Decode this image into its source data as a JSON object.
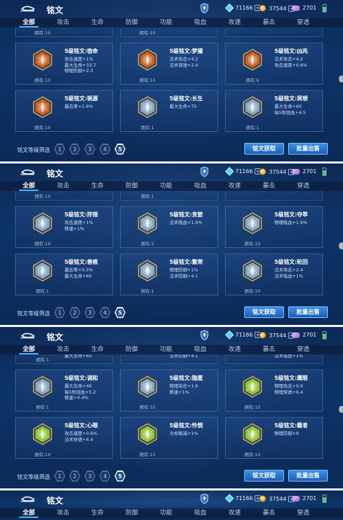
{
  "page_title": "铭文",
  "resources": [
    {
      "icon": "diamond-icon",
      "value": "71166"
    },
    {
      "icon": "gold-coin-icon",
      "value": "37544"
    },
    {
      "icon": "gem-icon",
      "value": "2701"
    }
  ],
  "tabs": [
    "全部",
    "攻击",
    "生命",
    "防御",
    "功能",
    "吸血",
    "攻速",
    "暴击",
    "穿透"
  ],
  "filter_label": "铭文等级筛选",
  "levels": [
    "1",
    "2",
    "3",
    "4",
    "5"
  ],
  "buttons": {
    "acquire": "铭文获取",
    "bulk_sell": "批量出售"
  },
  "panels": [
    {
      "strip": [
        {
          "own": "拥有:10",
          "stat": ""
        },
        {
          "own": "拥有:10",
          "stat": ""
        },
        {
          "own": "",
          "stat": ""
        }
      ],
      "cards": [
        {
          "name": "5级铭文:宿命",
          "stats": [
            "攻击速度+1%",
            "最大生命+33.7",
            "物理防御+2.3"
          ],
          "own": "拥有:10",
          "color": "#e0651c",
          "icon": "fate-inscription-icon"
        },
        {
          "name": "5级铭文:梦魇",
          "stats": [
            "法术攻击+4.2",
            "法术穿透+2.4"
          ],
          "own": "拥有:10",
          "color": "#e0651c",
          "icon": "nightmare-inscription-icon"
        },
        {
          "name": "5级铭文:凶兆",
          "stats": [
            "法术攻击+4.2",
            "攻击速度+0.6%"
          ],
          "own": "拥有:6",
          "color": "#e0651c",
          "icon": "omen-inscription-icon"
        },
        {
          "name": "5级铭文:祸源",
          "stats": [
            "暴击率+1.6%"
          ],
          "own": "拥有:10",
          "color": "#e0651c",
          "icon": "calamity-inscription-icon"
        },
        {
          "name": "5级铭文:长生",
          "stats": [
            "最大生命+75"
          ],
          "own": "拥有:1",
          "color": "#8fb6cf",
          "icon": "longevity-inscription-icon"
        },
        {
          "name": "5级铭文:冥想",
          "stats": [
            "最大生命+60",
            "每5秒回血+4.5"
          ],
          "own": "拥有:1",
          "color": "#8fb6cf",
          "icon": "meditation-inscription-icon"
        }
      ]
    },
    {
      "strip": [
        {
          "own": "拥有:10",
          "stat": ""
        },
        {
          "own": "拥有:1",
          "stat": ""
        },
        {
          "own": "",
          "stat": ""
        }
      ],
      "cards": [
        {
          "name": "5级铭文:狩猎",
          "stats": [
            "攻击速度+1%",
            "移速+1%"
          ],
          "own": "拥有:10",
          "color": "#8fb6cf",
          "icon": "hunting-inscription-icon"
        },
        {
          "name": "5级铭文:贪婪",
          "stats": [
            "法术吸血+1.6%"
          ],
          "own": "拥有:5",
          "color": "#8fb6cf",
          "icon": "greed-inscription-icon"
        },
        {
          "name": "5级铭文:夺萃",
          "stats": [
            "物理吸血+1.6%"
          ],
          "own": "拥有:10",
          "color": "#8fb6cf",
          "icon": "plunder-inscription-icon"
        },
        {
          "name": "5级铭文:兽痕",
          "stats": [
            "暴击率+0.5%",
            "最大生命+60"
          ],
          "own": "拥有:1",
          "color": "#8fb6cf",
          "icon": "beast-mark-inscription-icon"
        },
        {
          "name": "5级铭文:繁荣",
          "stats": [
            "物理防御+1%",
            "法术防御+4.1"
          ],
          "own": "拥有:1",
          "color": "#8fb6cf",
          "icon": "prosperity-inscription-icon"
        },
        {
          "name": "5级铭文:轮回",
          "stats": [
            "法术攻击+2.4",
            "法术吸血+1%"
          ],
          "own": "拥有:10",
          "color": "#8fb6cf",
          "icon": "reincarnation-inscription-icon"
        }
      ]
    },
    {
      "strip": [
        {
          "own": "拥有:1",
          "stat": "最大生命+60"
        },
        {
          "own": "",
          "stat": "法术防御+4.1"
        },
        {
          "own": "",
          "stat": "法术吸血+1%"
        }
      ],
      "cards": [
        {
          "name": "5级铭文:调和",
          "stats": [
            "最大生命+45",
            "每5秒回血+5.2",
            "移速+0.4%"
          ],
          "own": "拥有:1",
          "color": "#8fb6cf",
          "icon": "harmony-inscription-icon"
        },
        {
          "name": "5级铭文:隐匿",
          "stats": [
            "物理攻击+1.6",
            "移速+1%"
          ],
          "own": "拥有:10",
          "color": "#8fb6cf",
          "icon": "stealth-inscription-icon"
        },
        {
          "name": "5级铭文:鹰眼",
          "stats": [
            "物理攻击+0.9",
            "物理穿透+6.4"
          ],
          "own": "拥有:10",
          "color": "#9ad634",
          "icon": "hawk-eye-inscription-icon"
        },
        {
          "name": "5级铭文:心眼",
          "stats": [
            "攻击速度+0.6%",
            "法术穿透+6.4"
          ],
          "own": "拥有:10",
          "color": "#9ad634",
          "icon": "mind-eye-inscription-icon"
        },
        {
          "name": "5级铭文:怜悯",
          "stats": [
            "冷却缩减+1%"
          ],
          "own": "拥有:10",
          "color": "#9ad634",
          "icon": "mercy-inscription-icon"
        },
        {
          "name": "5级铭文:霸者",
          "stats": [
            "物理防御+9"
          ],
          "own": "拥有:10",
          "color": "#9ad634",
          "icon": "overlord-inscription-icon"
        }
      ]
    },
    {
      "strip": [],
      "cards": []
    }
  ]
}
